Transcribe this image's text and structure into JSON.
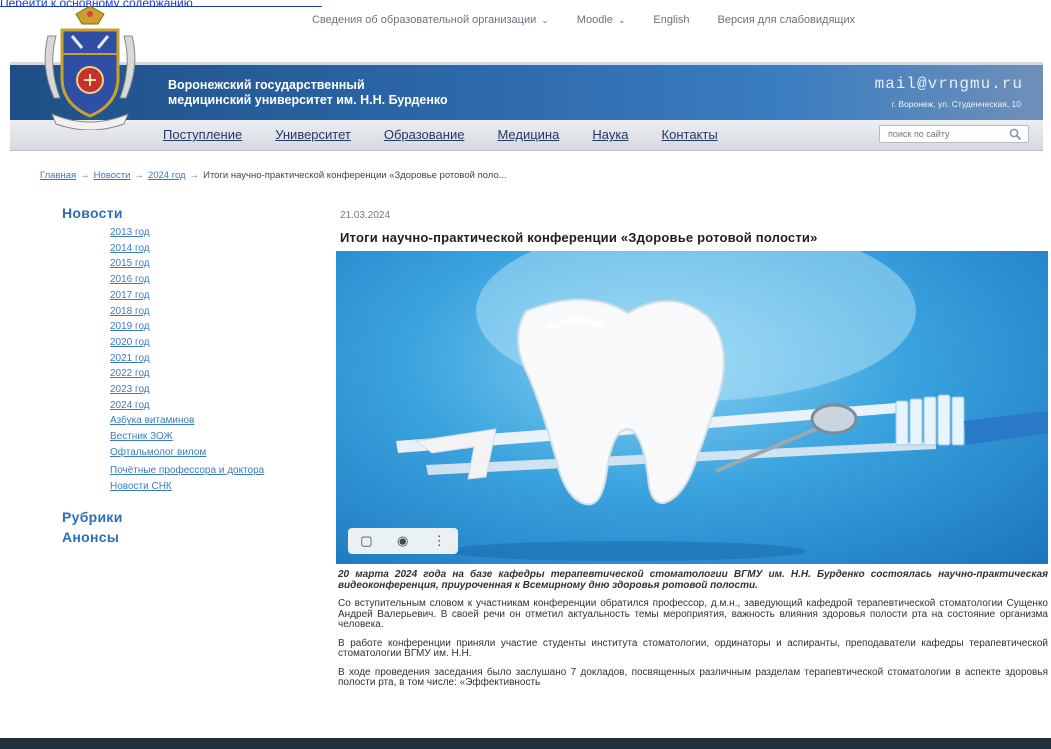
{
  "skip_link": {
    "label": "Перейти к основному содержанию"
  },
  "top_menu": {
    "items": [
      {
        "label": "Сведения об образовательной организации",
        "has_dropdown": true
      },
      {
        "label": "Moodle",
        "has_dropdown": true
      },
      {
        "label": "English",
        "has_dropdown": false
      },
      {
        "label": "Версия для слабовидящих",
        "has_dropdown": false
      }
    ]
  },
  "header": {
    "university_line1": "Воронежский государственный",
    "university_line2": "медицинский университет им. Н.Н. Бурденко",
    "email": "mail@vrngmu.ru",
    "address": "г. Воронеж, ул. Студенческая, 10"
  },
  "main_nav": {
    "items": [
      "Поступление",
      "Университет",
      "Образование",
      "Медицина",
      "Наука",
      "Контакты"
    ],
    "search_placeholder": "поиск по сайту"
  },
  "breadcrumb": {
    "home": "Главная",
    "news": "Новости",
    "year": "2024 год",
    "current": "Итоги научно-практической конференции «Здоровье ротовой поло..."
  },
  "sidebar": {
    "news_heading": "Новости",
    "news_items": [
      "2013 год",
      "2014 год",
      "2015 год",
      "2016 год",
      "2017 год",
      "2018 год",
      "2019 год",
      "2020 год",
      "2021 год",
      "2022 год",
      "2023 год",
      "2024 год",
      "Азбука витаминов",
      "Вестник ЗОЖ",
      "Офтальмолог вилом",
      "Почётные профессора и доктора",
      "Новости СНК"
    ],
    "rubrics_heading": "Рубрики",
    "announcements_heading": "Анонсы"
  },
  "article": {
    "date": "21.03.2024",
    "title": "Итоги научно-практической конференции «Здоровье ротовой полости»",
    "lead": "20 марта 2024 года на базе кафедры терапевтической стоматологии ВГМУ им. Н.Н. Бурденко состоялась научно-практическая видеоконференция, приуроченная к Всемирному дню здоровья ротовой полости.",
    "paragraphs": [
      "Со вступительным словом к участникам конференции обратился профессор, д.м.н., заведующий кафедрой терапевтической стоматологии Сущенко Андрей Валерьевич. В своей речи он отметил актуальность темы мероприятия, важность влияния здоровья полости рта на состояние организма человека.",
      "В работе конференции приняли участие студенты института стоматологии, ординаторы и аспиранты, преподаватели кафедры терапевтической стоматологии ВГМУ им. Н.Н.",
      "В ходе проведения заседания было заслушано 7 докладов, посвященных различным разделам терапевтической стоматологии в аспекте здоровья полости рта, в том числе: «Эффективность"
    ],
    "image_toolbar": {
      "icons": [
        "bookmark-icon",
        "camera-icon",
        "more-icon"
      ]
    }
  },
  "colors": {
    "banner": "#2b66a7",
    "link": "#3a7cc0",
    "heading": "#2d6fb5",
    "footer": "#20303d"
  }
}
